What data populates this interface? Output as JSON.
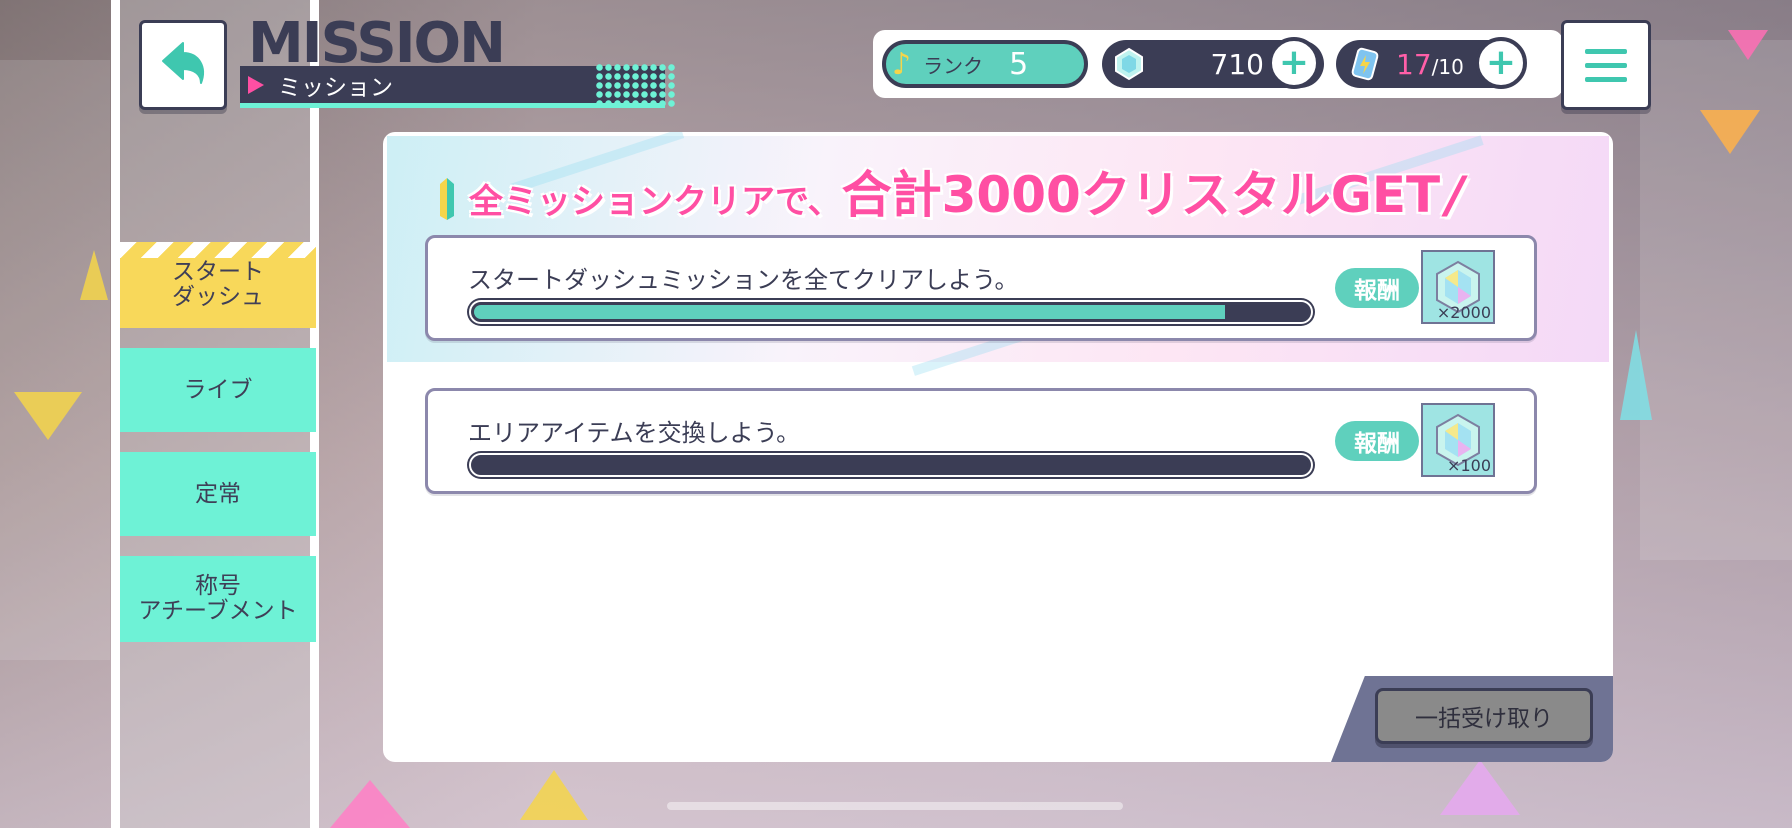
{
  "header": {
    "title": "MISSION",
    "subtitle": "ミッション"
  },
  "status": {
    "rank_label": "ランク",
    "rank_value": "5",
    "crystals": "710",
    "energy_current": "17",
    "energy_max": "/10"
  },
  "sidebar": {
    "items": [
      {
        "label": "スタート\nダッシュ",
        "active": true
      },
      {
        "label": "ライブ",
        "active": false
      },
      {
        "label": "定常",
        "active": false
      },
      {
        "label": "称号\nアチーブメント",
        "active": false
      }
    ]
  },
  "banner": {
    "prefix": "全ミッションクリアで、",
    "highlight": "合計3000クリスタルGET",
    "suffix": "/"
  },
  "missions": [
    {
      "text": "スタートダッシュミッションを全てクリアしよう。",
      "progress": 0.9,
      "reward_label": "報酬",
      "reward_qty": "×2000"
    },
    {
      "text": "エリアアイテムを交換しよう。",
      "progress": 0.0,
      "reward_label": "報酬",
      "reward_qty": "×100"
    }
  ],
  "actions": {
    "claim_all": "一括受け取り"
  },
  "colors": {
    "navy": "#3b3d55",
    "mint": "#6ef2d6",
    "teal": "#5fd0bd",
    "pink": "#ff4fa3",
    "yellow": "#f8d85a"
  },
  "icons": {
    "back": "back-arrow-icon",
    "menu": "hamburger-menu-icon",
    "rank": "music-note-icon",
    "crystal": "crystal-icon",
    "energy": "energy-battery-icon",
    "plus": "plus-icon",
    "beginner": "beginner-leaf-icon"
  }
}
